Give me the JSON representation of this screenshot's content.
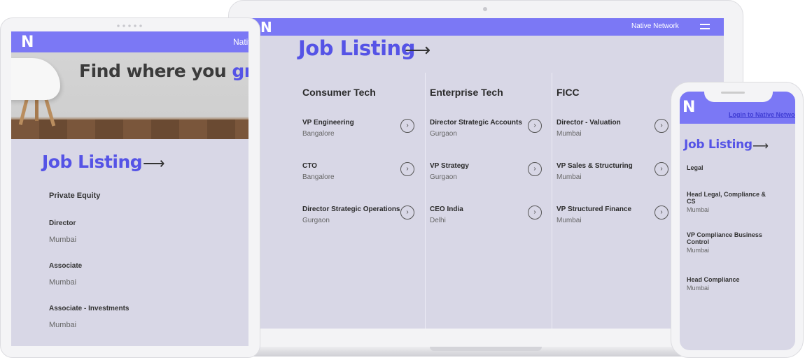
{
  "laptop": {
    "brand": "Native Network",
    "title": "Job Listing",
    "arrow": "⟶",
    "columns": [
      {
        "heading": "Consumer Tech",
        "jobs": [
          {
            "title": "VP Engineering",
            "location": "Bangalore"
          },
          {
            "title": "CTO",
            "location": "Bangalore"
          },
          {
            "title": "Director Strategic Operations",
            "location": "Gurgaon"
          }
        ]
      },
      {
        "heading": "Enterprise Tech",
        "jobs": [
          {
            "title": "Director Strategic Accounts",
            "location": "Gurgaon"
          },
          {
            "title": "VP Strategy",
            "location": "Gurgaon"
          },
          {
            "title": "CEO India",
            "location": "Delhi"
          }
        ]
      },
      {
        "heading": "FICC",
        "jobs": [
          {
            "title": "Director - Valuation",
            "location": "Mumbai"
          },
          {
            "title": "VP Sales & Structuring",
            "location": "Mumbai"
          },
          {
            "title": "VP Structured Finance",
            "location": "Mumbai"
          }
        ]
      }
    ],
    "chevron": "›"
  },
  "tablet": {
    "brand": "Native Network",
    "hero_text": "Find where you ",
    "hero_accent": "grow",
    "title": "Job Listing",
    "arrow": "⟶",
    "category": "Private Equity",
    "jobs": [
      {
        "title": "Director",
        "location": "Mumbai"
      },
      {
        "title": "Associate",
        "location": "Mumbai"
      },
      {
        "title": "Associate - Investments",
        "location": "Mumbai"
      }
    ]
  },
  "phone": {
    "login": "Login to Native Network",
    "title": "Job Listing",
    "arrow": "⟶",
    "category": "Legal",
    "jobs": [
      {
        "title": "Head Legal, Compliance & CS",
        "location": "Mumbai"
      },
      {
        "title": "VP Compliance Business Control",
        "location": "Mumbai"
      },
      {
        "title": "Head Compliance",
        "location": "Mumbai"
      }
    ]
  },
  "logo": "N",
  "colors": {
    "accent": "#5553e6",
    "nav": "#7b78f5",
    "screen_bg": "#d8d7e6"
  }
}
